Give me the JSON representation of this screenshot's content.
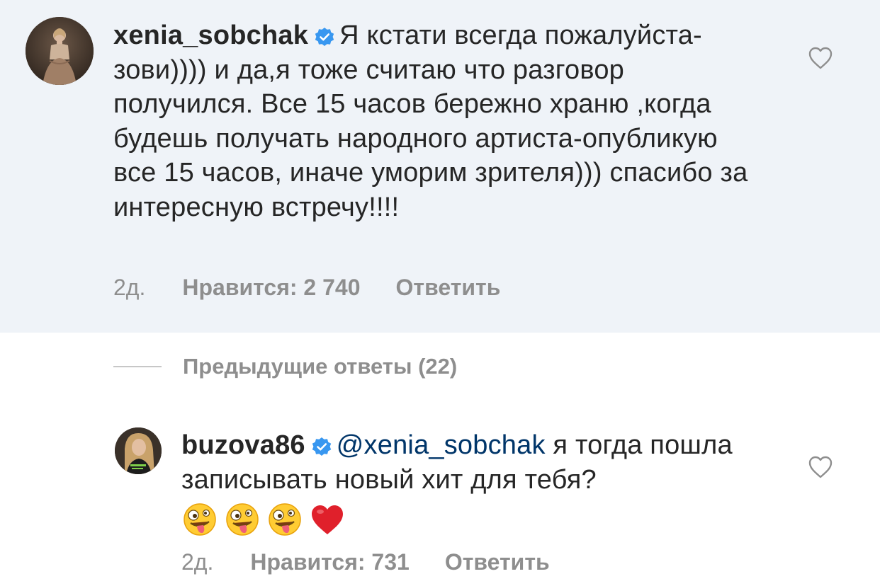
{
  "main_comment": {
    "username": "xenia_sobchak",
    "text": "Я кстати всегда пожалуйста-зови)))) и  да,я тоже считаю что разговор получился. Все 15 часов бережно храню ,когда будешь получать народного артиста-опубликую все 15 часов, иначе уморим зрителя))) спасибо за интересную встречу!!!!",
    "time": "2д.",
    "likes": "Нравится: 2 740",
    "reply_label": "Ответить",
    "verified": true
  },
  "previous_replies": {
    "label": "Предыдущие ответы (22)"
  },
  "reply_comment": {
    "username": "buzova86",
    "mention": "@xenia_sobchak",
    "text": " я тогда пошла записывать новый хит для тебя?",
    "emojis": [
      "zany-face",
      "zany-face",
      "zany-face",
      "red-heart"
    ],
    "time": "2д.",
    "likes": "Нравится: 731",
    "reply_label": "Ответить",
    "verified": true
  },
  "colors": {
    "highlight_background": "#eff3f8",
    "verified_blue": "#3897f0",
    "mention_blue": "#003569",
    "meta_gray": "#8e8e8e"
  }
}
